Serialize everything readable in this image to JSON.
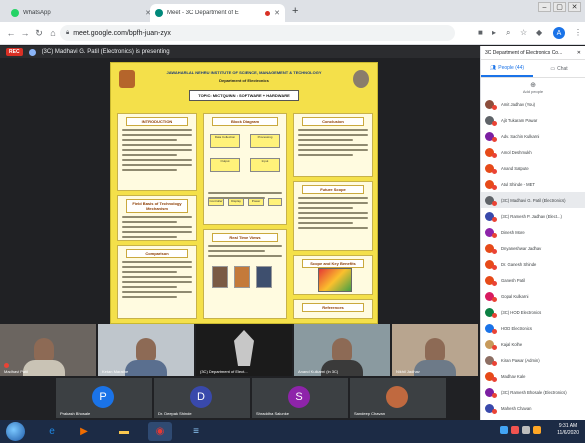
{
  "browser": {
    "tabs": [
      {
        "label": "WhatsApp",
        "favicon_color": "#25d366",
        "active": false
      },
      {
        "label": "Meet - 3C Department of E",
        "favicon_color": "#00897b",
        "active": true
      }
    ],
    "new_tab_icon": "plus-icon",
    "window_buttons": [
      "–",
      "▢",
      "✕"
    ],
    "url": "meet.google.com/bpfh-juan-zyx",
    "profile_initial": "A"
  },
  "meet": {
    "presenting_text": "(3C) Madhavi G. Patil (Electronics) is presenting",
    "rec_label": "REC",
    "slide": {
      "institution": "JAWAHARLAL NEHRU INSTITUTE OF SCIENCE, MANAGEMENT & TECHNOLOGY",
      "department": "Department of Electronics",
      "topic": "TOPIC: MICTQUINN : SOFTWARE + HARDWARE",
      "panels": [
        {
          "title": "INTRODUCTION"
        },
        {
          "title": "Block Diagram"
        },
        {
          "title": "Conclusion"
        },
        {
          "title": "Field Basis of Technology Mechanism"
        },
        {
          "title": "Comparison"
        },
        {
          "title": "Real Time Views"
        },
        {
          "title": "Future Scope"
        },
        {
          "title": "Future Scope"
        },
        {
          "title": "Scope and Key Benefits"
        },
        {
          "title": "References"
        }
      ],
      "flow_labels": [
        "Data Collection",
        "Processing",
        "Output",
        "Input",
        "Controller",
        "Display",
        "Power"
      ],
      "colors": {
        "background": "#f4e04a",
        "panel": "#fffbe0",
        "title_text": "#8c3b00"
      }
    },
    "tiles": [
      {
        "name": "Madhavi Patil",
        "shirt": "#c9c3b5",
        "bg": "#6b6560"
      },
      {
        "name": "Ketan Marathe",
        "shirt": "#5a6f8f",
        "bg": "#bfc6cc"
      },
      {
        "name": "(3C) Department of Elect...",
        "shirt": "#c7c7c7",
        "bg": "#1b1b1b"
      },
      {
        "name": "Anand Kulkarni (in 3C)",
        "shirt": "#3a3a3a",
        "bg": "#8a9aa0"
      },
      {
        "name": "Nikhil Jadhav",
        "shirt": "#6d7a88",
        "bg": "#b8a58f"
      }
    ],
    "letter_tiles": [
      {
        "initial": "P",
        "name": "Prakash Bhosale",
        "color": "#1a73e8"
      },
      {
        "initial": "D",
        "name": "Dr. Deepak Shinde",
        "color": "#3949ab"
      },
      {
        "initial": "S",
        "name": "Shraddha Salunke",
        "color": "#8e24aa"
      },
      {
        "initial": "",
        "name": "Sandeep Chavan",
        "color": "#c0693f"
      }
    ]
  },
  "people_panel": {
    "header": "3C Department of Electronics Co...",
    "tab_people": "People (44)",
    "tab_chat": "Chat",
    "add_people": "Add people",
    "participants": [
      {
        "name": "Amit Jadhav (You)",
        "color": "#8d4e3c"
      },
      {
        "name": "Ajit Tukaram Pawar",
        "color": "#5f6368"
      },
      {
        "name": "Adv. Sachin Kulkarni",
        "color": "#7b1fa2"
      },
      {
        "name": "Amol Deshmukh",
        "color": "#e64a19"
      },
      {
        "name": "Anand Satpute",
        "color": "#e64a19"
      },
      {
        "name": "Atul Shinde - MET",
        "color": "#e64a19"
      },
      {
        "name": "(3C) Madhavi G. Patil (Electronics)",
        "color": "#5f6368"
      },
      {
        "name": "(3C) Ramesh P. Jadhav (Elect...)",
        "color": "#3949ab"
      },
      {
        "name": "Dinesh More",
        "color": "#8e24aa"
      },
      {
        "name": "Dnyaneshwar Jadhav",
        "color": "#e64a19"
      },
      {
        "name": "Dr. Ganesh Shinde",
        "color": "#e64a19"
      },
      {
        "name": "Ganesh Patil",
        "color": "#e64a19"
      },
      {
        "name": "Gopal Kulkarni",
        "color": "#d81b60"
      },
      {
        "name": "(3C) HOD Electronics",
        "color": "#0b8043"
      },
      {
        "name": "HOD Electronics",
        "color": "#1a73e8"
      },
      {
        "name": "Kajal Kolhe",
        "color": "#c79a5b"
      },
      {
        "name": "Kiran Pawar (Admin)",
        "color": "#8d6e63"
      },
      {
        "name": "Madhav Kale",
        "color": "#e64a19"
      },
      {
        "name": "(3C) Ramesh Bhosale (Electronics)",
        "color": "#7b1fa2"
      },
      {
        "name": "Mahesh Chavan",
        "color": "#3949ab"
      },
      {
        "name": "Manoj Sawant",
        "color": "#d81b60"
      }
    ]
  },
  "taskbar": {
    "apps": [
      {
        "icon": "ie-icon",
        "glyph": "e",
        "color": "#1e88e5"
      },
      {
        "icon": "media-player-icon",
        "glyph": "▶",
        "color": "#ef6c00"
      },
      {
        "icon": "folder-icon",
        "glyph": "▬",
        "color": "#f9c74f"
      },
      {
        "icon": "chrome-icon",
        "glyph": "◉",
        "color": "#e53935"
      },
      {
        "icon": "notepad-icon",
        "glyph": "≡",
        "color": "#90caf9"
      }
    ],
    "time": "9:31 AM",
    "date": "11/6/2020"
  }
}
